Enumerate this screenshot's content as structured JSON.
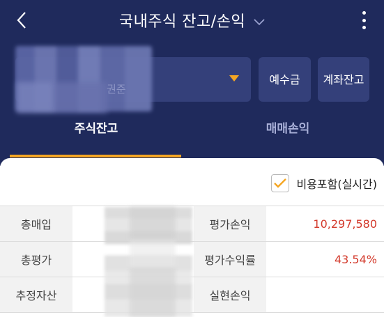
{
  "header": {
    "title": "국내주식 잔고/손익",
    "back_icon": "chevron-left-icon",
    "dropdown_icon": "chevron-down-icon",
    "more_icon": "more-vertical-icon"
  },
  "account": {
    "name_suffix": "권준",
    "dropdown_icon": "caret-down-icon",
    "accent": "#f5a623"
  },
  "buttons": {
    "deposit": "예수금",
    "account_balance_line1": "계좌",
    "account_balance_line2": "잔고"
  },
  "tabs": [
    {
      "label": "주식잔고",
      "selected": true
    },
    {
      "label": "매매손익",
      "selected": false
    }
  ],
  "options": {
    "include_fees_label": "비용포함(실시간)",
    "include_fees_checked": true
  },
  "summary": {
    "rows": [
      {
        "left_label": "총매입",
        "right_label": "평가손익",
        "right_value": "10,297,580"
      },
      {
        "left_label": "총평가",
        "right_label": "평가수익률",
        "right_value": "43.54%"
      },
      {
        "left_label": "추정자산",
        "right_label": "실현손익",
        "right_value": ""
      }
    ]
  },
  "colors": {
    "header_bg": "#1f2a5c",
    "profit_red": "#d33a2c"
  }
}
